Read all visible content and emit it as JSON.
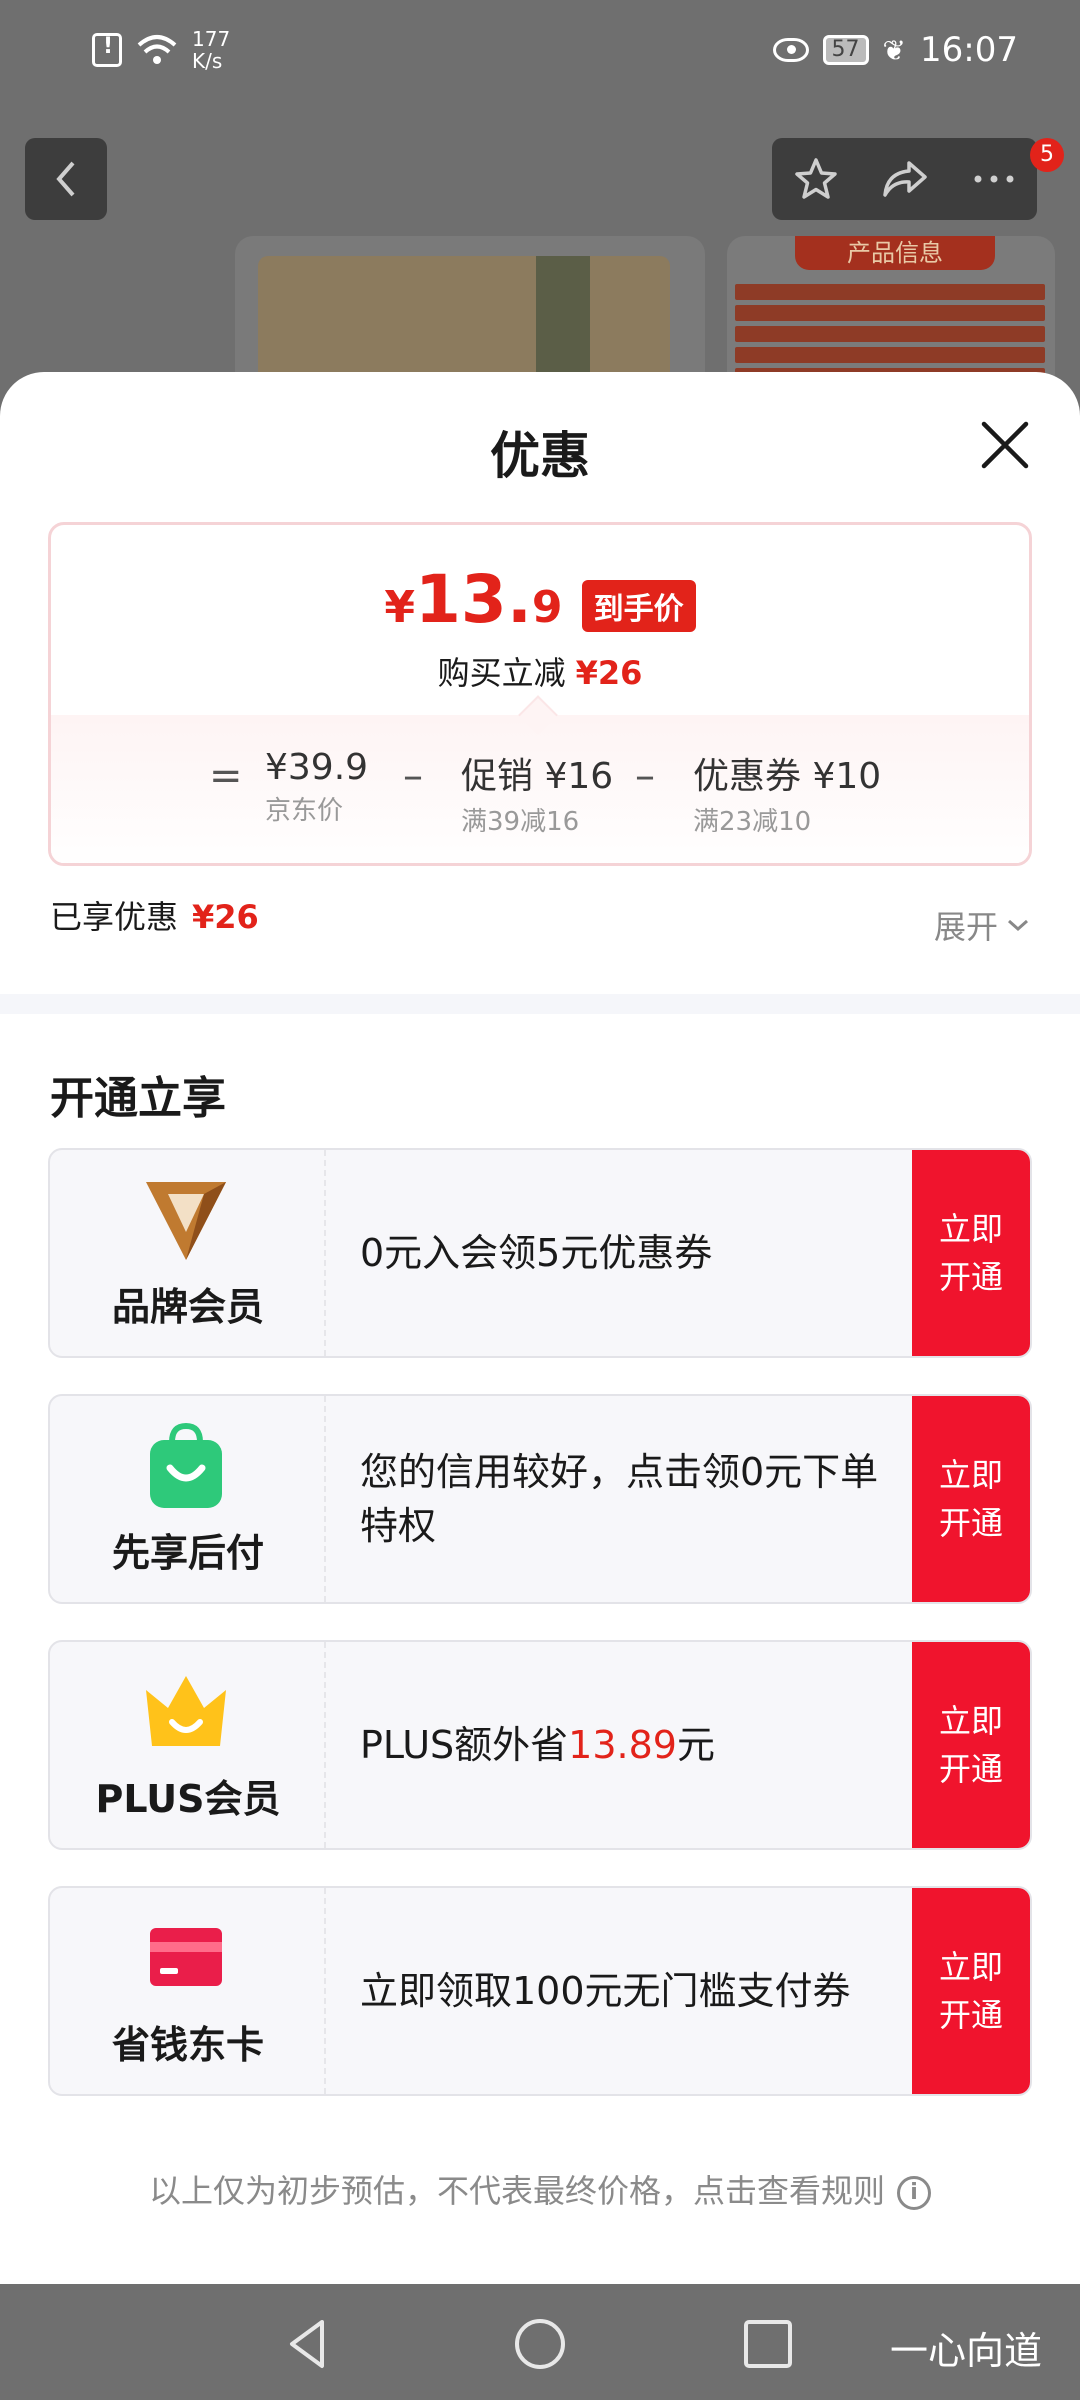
{
  "status_bar": {
    "net_speed_value": "177",
    "net_speed_unit": "K/s",
    "battery": "57",
    "time": "16:07"
  },
  "background": {
    "notification_badge": "5",
    "info_card_title": "产品信息"
  },
  "sheet": {
    "title": "优惠",
    "price_box": {
      "currency": "¥",
      "price_integer": "13.",
      "price_decimal": "9",
      "tag": "到手价",
      "savings_label": "购买立减",
      "savings_value": "¥26",
      "formula": {
        "equals": "=",
        "base_price": "¥39.9",
        "base_label": "京东价",
        "minus1": "–",
        "promo_title": "促销",
        "promo_value": "¥16",
        "promo_rule": "满39减16",
        "minus2": "–",
        "coupon_title": "优惠券",
        "coupon_value": "¥10",
        "coupon_rule": "满23减10"
      }
    },
    "enjoyed_label": "已享优惠",
    "enjoyed_value": "¥26",
    "expand_label": "展开",
    "section_title": "开通立享",
    "cards": [
      {
        "icon": "brand-member-v-icon",
        "name": "品牌会员",
        "desc": "0元入会领5元优惠券",
        "button_line1": "立即",
        "button_line2": "开通"
      },
      {
        "icon": "shopping-bag-smile-icon",
        "name": "先享后付",
        "desc": "您的信用较好，点击领0元下单特权",
        "button_line1": "立即",
        "button_line2": "开通"
      },
      {
        "icon": "crown-icon",
        "name": "PLUS会员",
        "desc_prefix": "PLUS额外省",
        "desc_amount": "13.89",
        "desc_suffix": "元",
        "button_line1": "立即",
        "button_line2": "开通"
      },
      {
        "icon": "card-icon",
        "name": "省钱东卡",
        "desc": "立即领取100元无门槛支付券",
        "button_line1": "立即",
        "button_line2": "开通"
      }
    ],
    "footnote": "以上仅为初步预估，不代表最终价格，点击查看规则",
    "info_icon_glyph": "i"
  },
  "nav_bar": {
    "brand": "一心向道"
  },
  "colors": {
    "accent_red": "#e2231a",
    "button_red": "#f0142d",
    "bag_green": "#2ec97a",
    "crown_yellow": "#ffc21a",
    "card_red": "#ea1e4a",
    "brand_bronze": "#b9702a"
  }
}
